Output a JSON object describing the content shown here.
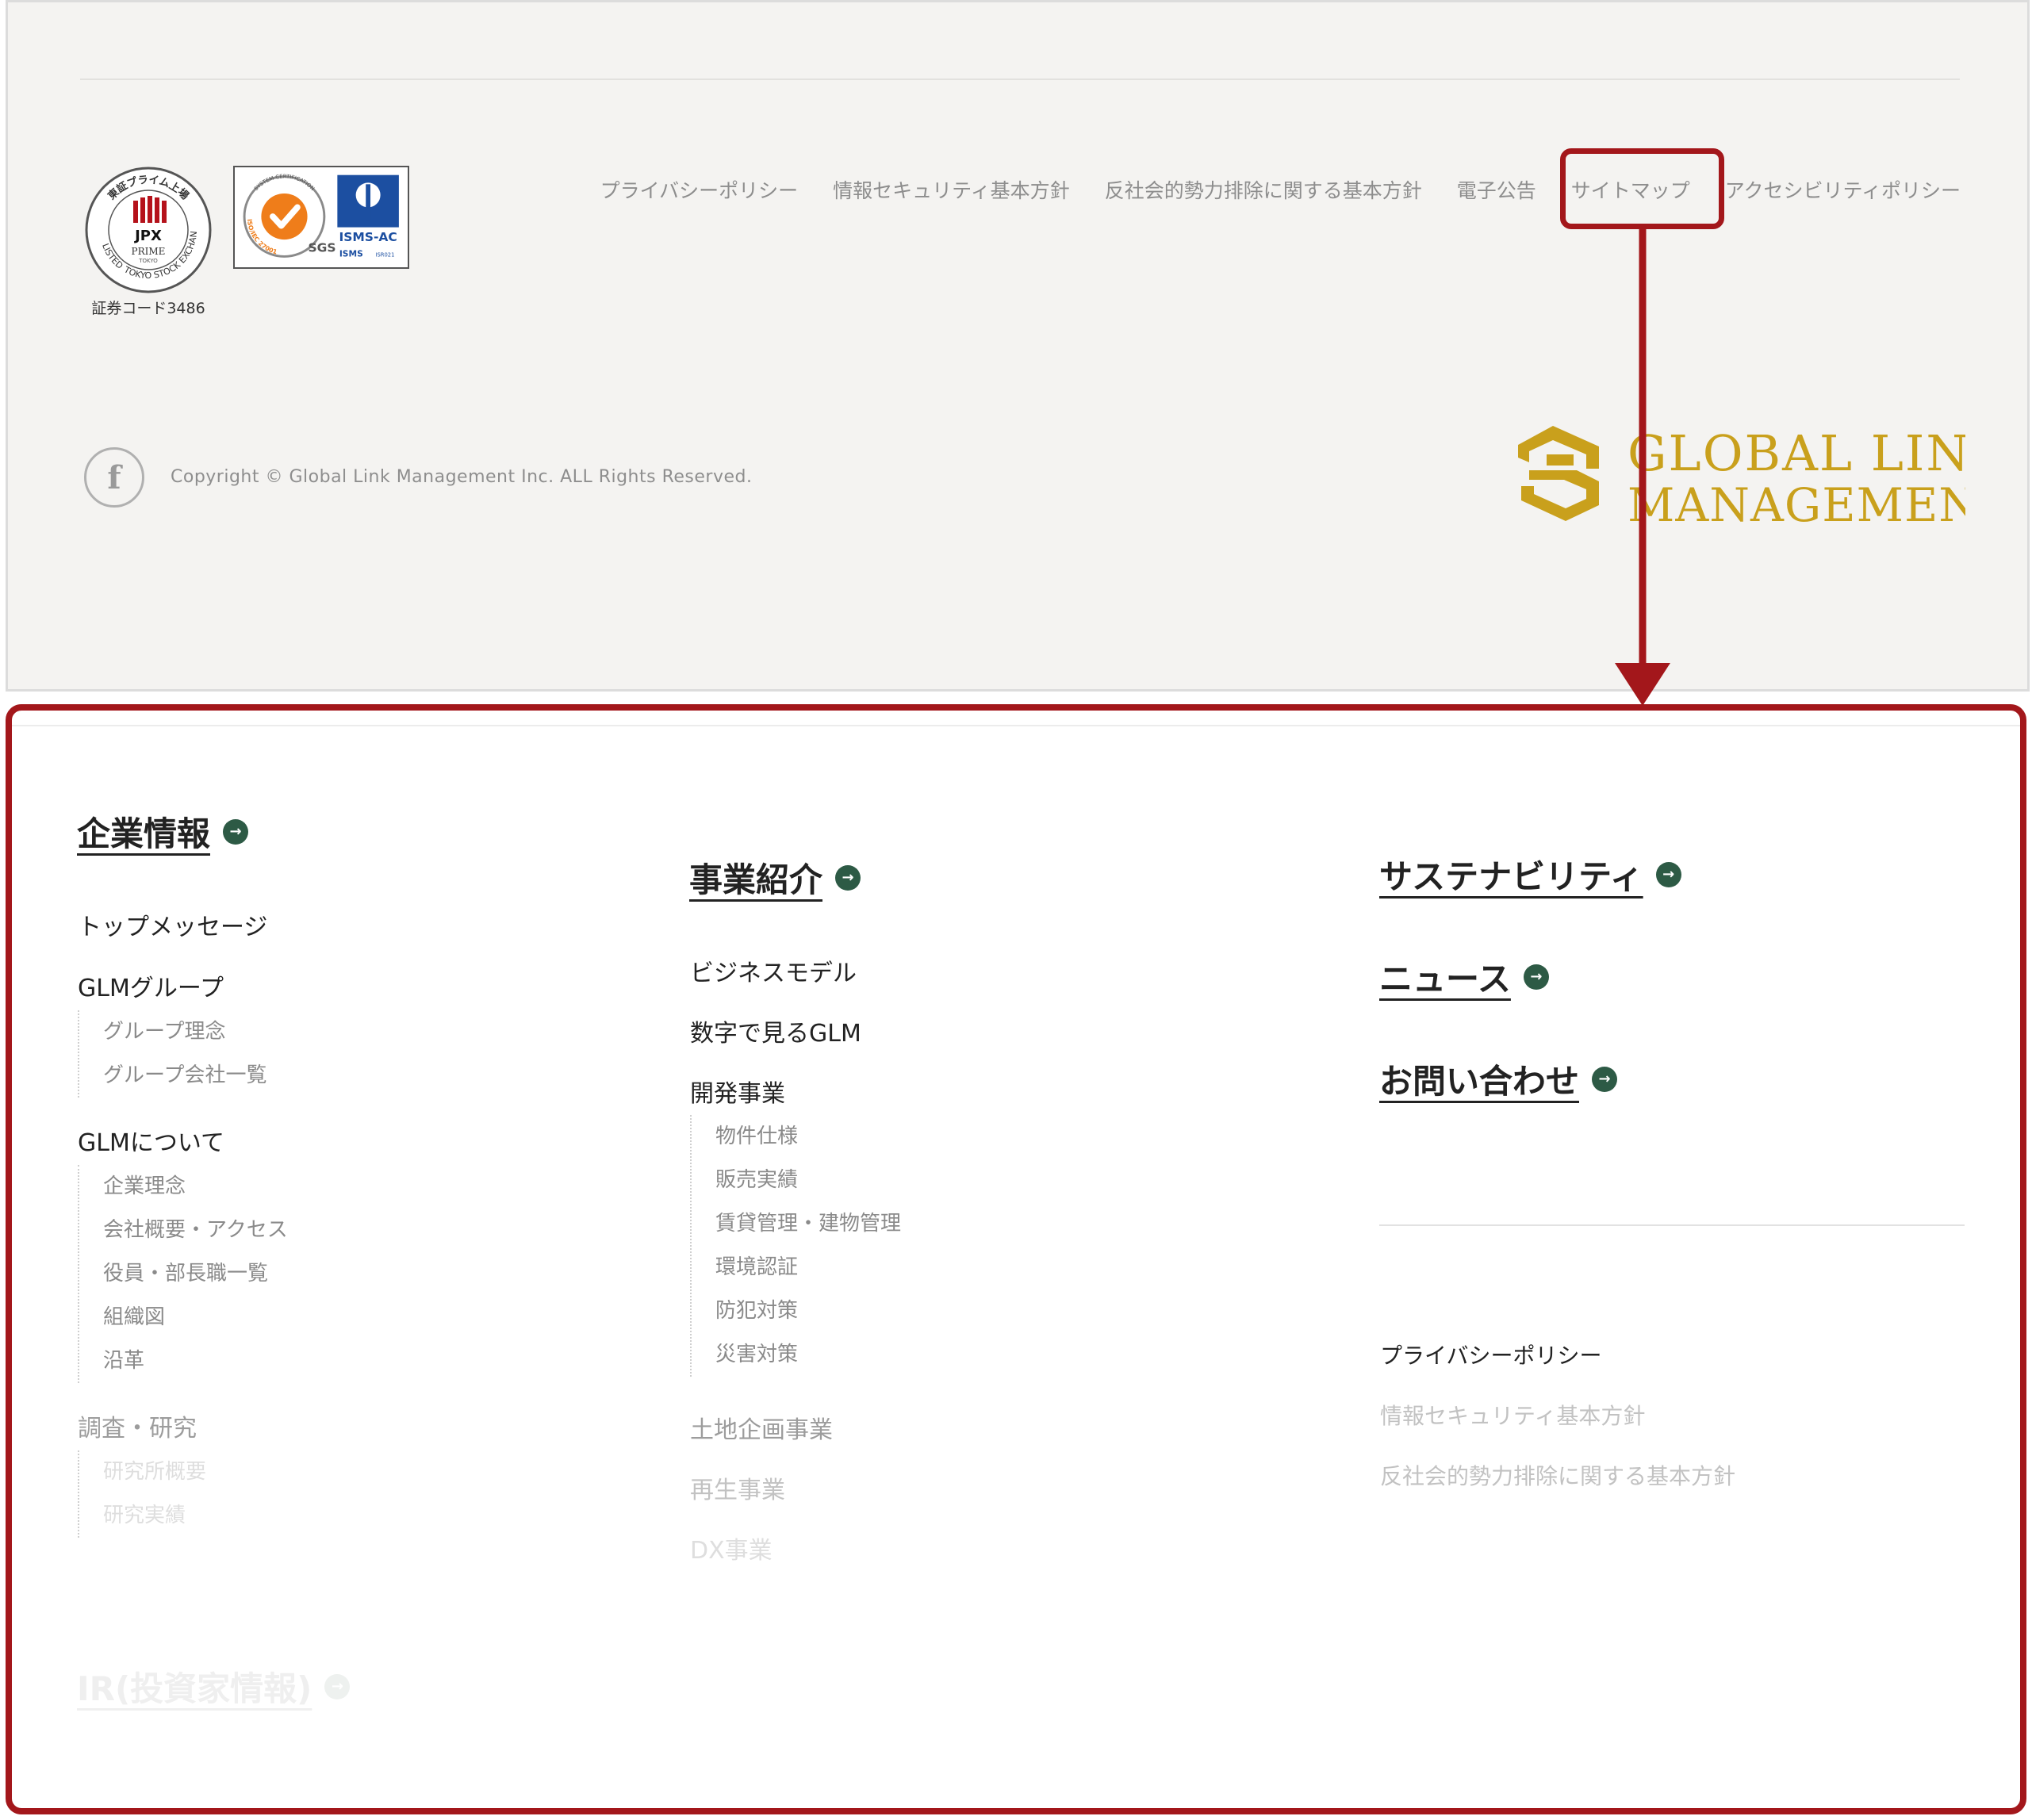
{
  "footer": {
    "stock_code": "証券コード3486",
    "tse_badge": {
      "ring_top": "東証プライム上場",
      "ring_left": "LISTED",
      "ring_right": "TOKYO STOCK EXCHANGE",
      "jpx": "JPX",
      "prime": "PRIME",
      "tokyo": "TOKYO"
    },
    "iso_badge": {
      "ring_top": "SYSTEM CERTIFICATION",
      "ring_bottom": "ISO/IEC 27001",
      "sgs": "SGS",
      "isms_ac": "ISMS-AC",
      "isms": "ISMS",
      "isr": "ISR021"
    },
    "legal_links": [
      "プライバシーポリシー",
      "情報セキュリティ基本方針",
      "反社会的勢力排除に関する基本方針",
      "電子公告",
      "サイトマップ",
      "アクセシビリティポリシー"
    ],
    "facebook_icon": "facebook-icon",
    "facebook_glyph": "f",
    "copyright": "Copyright © Global Link Management Inc. ALL Rights Reserved.",
    "brand": {
      "line1": "GLOBAL LINK",
      "line2": "MANAGEMENT",
      "color": "#c9a01c"
    }
  },
  "annotation": {
    "color": "#a3171b",
    "highlighted_link": "サイトマップ"
  },
  "sitemap": {
    "go_icon_glyph": "→",
    "col1": {
      "title": "企業情報",
      "items": [
        {
          "label": "トップメッセージ"
        },
        {
          "label": "GLMグループ",
          "subs": [
            "グループ理念",
            "グループ会社一覧"
          ]
        },
        {
          "label": "GLMについて",
          "subs": [
            "企業理念",
            "会社概要・アクセス",
            "役員・部長職一覧",
            "組織図",
            "沿革"
          ]
        },
        {
          "label": "調査・研究",
          "subs": [
            "研究所概要",
            "研究実績"
          ]
        }
      ],
      "faded_title": "IR(投資家情報)"
    },
    "col2": {
      "title": "事業紹介",
      "items": [
        {
          "label": "ビジネスモデル"
        },
        {
          "label": "数字で見るGLM"
        },
        {
          "label": "開発事業",
          "subs": [
            "物件仕様",
            "販売実績",
            "賃貸管理・建物管理",
            "環境認証",
            "防犯対策",
            "災害対策"
          ]
        },
        {
          "label": "土地企画事業"
        },
        {
          "label": "再生事業"
        },
        {
          "label": "DX事業"
        }
      ]
    },
    "col3": {
      "titles": [
        "サステナビリティ",
        "ニュース",
        "お問い合わせ"
      ],
      "policies": [
        "プライバシーポリシー",
        "情報セキュリティ基本方針",
        "反社会的勢力排除に関する基本方針"
      ]
    }
  }
}
